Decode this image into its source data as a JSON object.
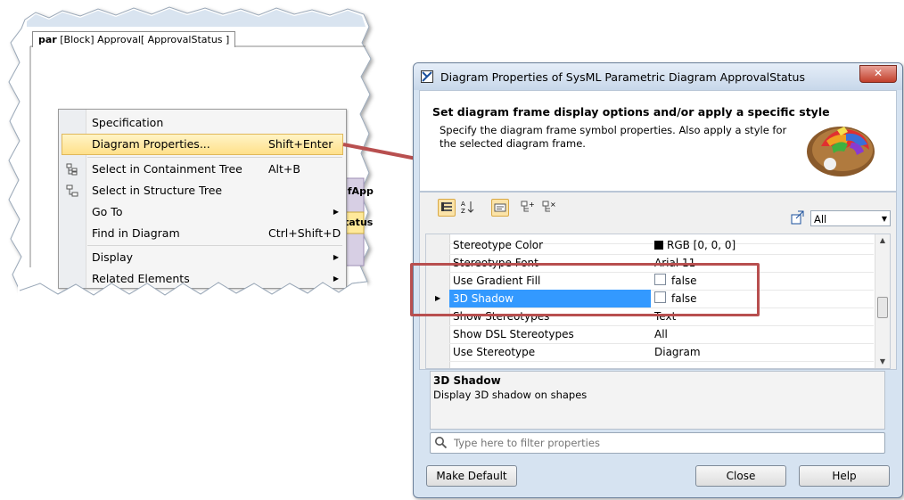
{
  "diagram": {
    "tab_kind": "par",
    "tab_text": "[Block] Approval[ ApprovalStatus ]",
    "bg_block_1": "lfApp",
    "bg_block_2": "tatus"
  },
  "context_menu": {
    "items": [
      {
        "label": "Specification",
        "shortcut": ""
      },
      {
        "label": "Diagram Properties...",
        "shortcut": "Shift+Enter"
      },
      {
        "label": "Select in Containment Tree",
        "shortcut": "Alt+B"
      },
      {
        "label": "Select in Structure Tree",
        "shortcut": ""
      },
      {
        "label": "Go To",
        "shortcut": ""
      },
      {
        "label": "Find in Diagram",
        "shortcut": "Ctrl+Shift+D"
      },
      {
        "label": "Display",
        "shortcut": ""
      },
      {
        "label": "Related Elements",
        "shortcut": ""
      }
    ]
  },
  "dialog": {
    "title": "Diagram Properties of SysML Parametric Diagram ApprovalStatus",
    "close_glyph": "✕",
    "header_title": "Set diagram frame display options and/or apply a specific style",
    "header_desc": "Specify the diagram frame symbol properties. Also apply a style for the selected diagram frame.",
    "filter_value": "All",
    "properties": [
      {
        "name": "Stereotype Color",
        "value": "RGB [0, 0, 0]"
      },
      {
        "name": "Stereotype Font",
        "value": "Arial 11"
      },
      {
        "name": "Use Gradient Fill",
        "value": "false"
      },
      {
        "name": "3D Shadow",
        "value": "false"
      },
      {
        "name": "Show Stereotypes",
        "value": "Text"
      },
      {
        "name": "Show DSL Stereotypes",
        "value": "All"
      },
      {
        "name": "Use Stereotype",
        "value": "Diagram"
      }
    ],
    "description_title": "3D Shadow",
    "description_text": "Display 3D shadow on shapes",
    "search_placeholder": "Type here to filter properties",
    "buttons": {
      "make_default": "Make Default",
      "close": "Close",
      "help": "Help"
    }
  },
  "colors": {
    "highlight_rect": "#b84f4f",
    "arrow": "#b84f4f",
    "selection": "#3399ff"
  }
}
